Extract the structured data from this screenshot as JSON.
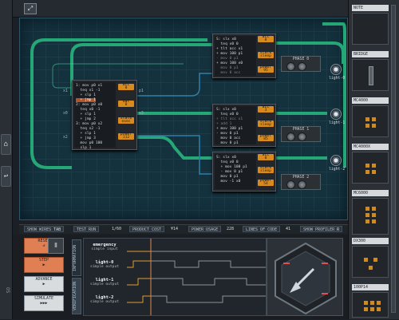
{
  "toolbar": {
    "expand_icon": "expand-arrows-icon"
  },
  "left_rail": {
    "icons": [
      "home-icon",
      "undo-icon"
    ]
  },
  "chips": [
    {
      "id": "chip-1",
      "lines": [
        "1: mov p0 x1",
        "  teq x1 -1",
        "  + slp 1",
        "  + jmp 1",
        "2: mov p0 x0",
        "  teq x0 -1",
        "  + slp 1",
        "  + jmp 2",
        "3: mov p0 x2",
        "  teq x2 -1",
        "  + slp 1",
        "  + jmp 3",
        "  mov p0 100",
        "  slp 1"
      ],
      "highlight_line": 3,
      "registers": [
        {
          "name": "acc",
          "value": "0"
        },
        {
          "name": "dat",
          "value": "0"
        },
        {
          "name": "state",
          "value": "exec"
        },
        {
          "name": "power",
          "value": "112"
        }
      ],
      "ports": {
        "x1": "x1",
        "p1": "p1",
        "x3": "x3",
        "x0": "x0",
        "x2": "x2"
      }
    },
    {
      "id": "chip-2",
      "lines": [
        "S: slx x0",
        "  teq x0 0",
        "+ tlt acc x1",
        "+ mov 100 p1",
        "- mov 0 p1",
        "+ mov 100 x0",
        "  mov 0 p1",
        "  mov 0 acc",
        "  mov -1 x0"
      ],
      "registers": [
        {
          "name": "acc",
          "value": "0"
        },
        {
          "name": "state",
          "value": "sleep"
        },
        {
          "name": "power",
          "value": "95"
        }
      ],
      "ports": {
        "p0": "p0",
        "x0": "x0",
        "x1": "x1",
        "p1": "p1"
      }
    },
    {
      "id": "chip-3",
      "lines": [
        "S: slx x0",
        "  teq x0 0",
        "+ tlt acc x1",
        "+ add 1",
        "+ mov 100 p1",
        "- mov 0 p1",
        "  mov 0 acc",
        "  mov 0 p1",
        "  mov -1 x0"
      ],
      "registers": [
        {
          "name": "acc",
          "value": "3"
        },
        {
          "name": "state",
          "value": "sleep"
        },
        {
          "name": "power",
          "value": "85"
        }
      ],
      "ports": {
        "x0": "x0",
        "x1": "x1",
        "p1": "p1"
      }
    },
    {
      "id": "chip-4",
      "lines": [
        "S: slx x0",
        "  teq x0 0",
        "  + mov 100 p1",
        "  - mov 0 p1",
        "  mov 0 p1",
        "  mov -1 x0"
      ],
      "registers": [
        {
          "name": "acc",
          "value": "0"
        },
        {
          "name": "state",
          "value": "sleep"
        },
        {
          "name": "power",
          "value": "54"
        }
      ],
      "ports": {
        "p0": "p0",
        "x0": "x0",
        "x1": "x1",
        "p1": "p1"
      }
    }
  ],
  "phases": [
    "PHASE 0",
    "PHASE 1",
    "PHASE 2"
  ],
  "lights": [
    "light-0",
    "light-1",
    "light-2"
  ],
  "right_panel": {
    "parts": [
      "NOTE",
      "BRIDGE",
      "MC4000",
      "MC4000X",
      "MC6000",
      "DX300",
      "100P14"
    ]
  },
  "status_bar": {
    "show_wires": "SHOW WIRES",
    "show_wires_val": "TAB",
    "test_run": "TEST RUN",
    "test_run_val": "1/60",
    "product_cost": "PRODUCT COST",
    "product_cost_val": "¥14",
    "power_usage": "POWER USAGE",
    "power_usage_val": "228",
    "lines_of_code": "LINES OF CODE",
    "lines_of_code_val": "41",
    "show_profiler": "SHOW PROFILER",
    "show_profiler_val": "R"
  },
  "controls": {
    "reset": "RESET",
    "step": "STEP",
    "advance": "ADVANCE",
    "simulate": "SIMULATE"
  },
  "tabs": [
    "INFORMATION",
    "VERIFICATION"
  ],
  "signals": [
    {
      "name": "emergency",
      "desc": "simple input"
    },
    {
      "name": "light-0",
      "desc": "simple output"
    },
    {
      "name": "light-1",
      "desc": "simple output"
    },
    {
      "name": "light-2",
      "desc": "simple output"
    }
  ],
  "logo": "OS"
}
